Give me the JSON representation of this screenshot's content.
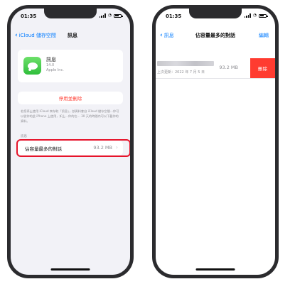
{
  "status": {
    "time": "01:35"
  },
  "left": {
    "back_label": "iCloud 儲存空間",
    "title": "訊息",
    "app": {
      "name": "訊息",
      "version": "14.0",
      "developer": "Apple Inc."
    },
    "delete_label": "停用並刪除",
    "description": "若您停止使用 iCloud 來存取「訊息」，該資料會自 iCloud 儲存空間…你可以從你的此 iPhone 上使用，如上…你的在… 30 天的時間內可以下載你的資料。",
    "section_label": "訊息",
    "row": {
      "label": "佔容量最多的對話",
      "size": "93.2 MB"
    }
  },
  "right": {
    "back_label": "訊息",
    "title": "佔容量最多的對話",
    "edit_label": "編輯",
    "conversation": {
      "name": "(blurred)",
      "date": "上次更新：2022 年 7 月 5 日",
      "size": "93.2 MB"
    },
    "delete_button": "刪除"
  }
}
